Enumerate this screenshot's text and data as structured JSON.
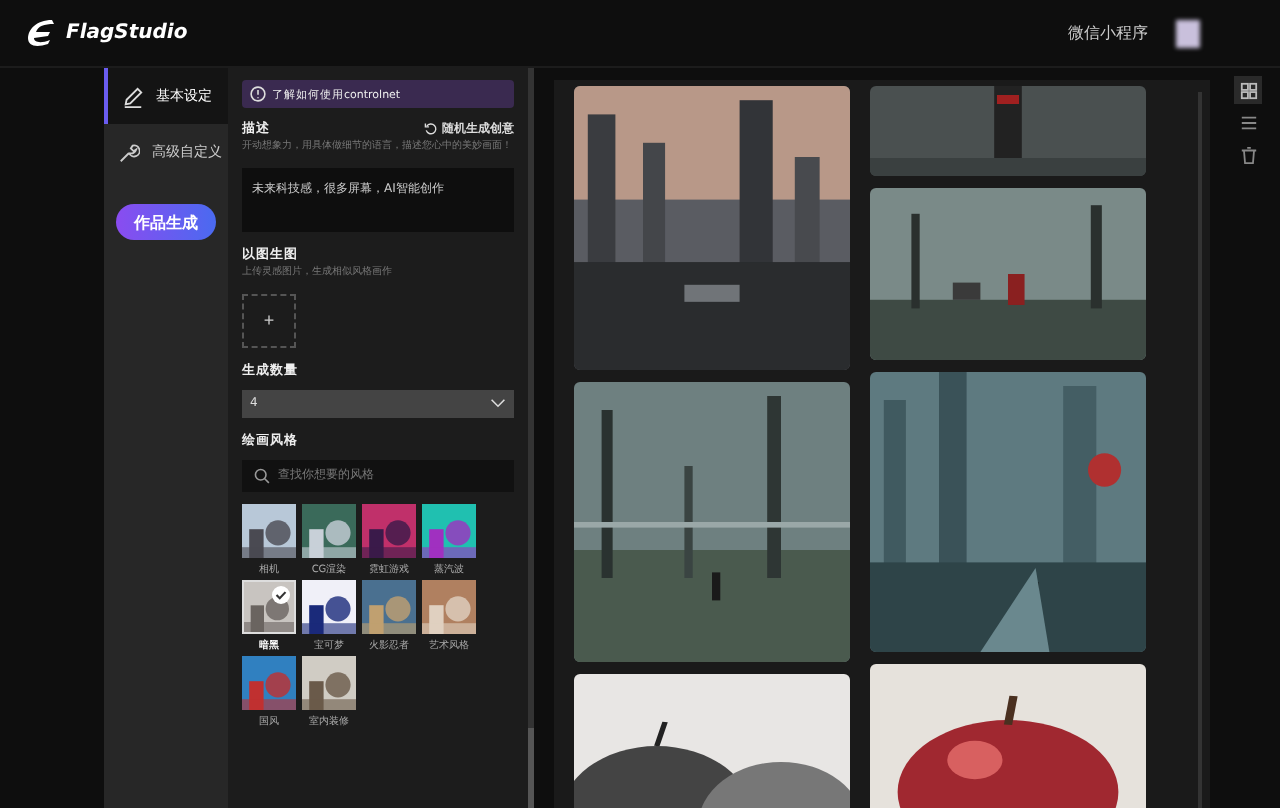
{
  "header": {
    "logo": "FlagStudio",
    "mini_program": "微信小程序"
  },
  "nav": {
    "items": [
      {
        "label": "基本设定",
        "kind": "pencil",
        "selected": true
      },
      {
        "label": "高级自定义",
        "kind": "wrench",
        "selected": false
      }
    ],
    "generate_button": "作品生成"
  },
  "settings": {
    "notice": "了解如何使用controlnet",
    "description": {
      "title": "描述",
      "random_button": "随机生成创意",
      "hint": "开动想象力，用具体做细节的语言，描述您心中的美妙画面！",
      "value": "未来科技感，很多屏幕，AI智能创作"
    },
    "image_to_image": {
      "title": "以图生图",
      "hint": "上传灵感图片，生成相似风格画作",
      "upload": "+"
    },
    "count": {
      "title": "生成数量",
      "value": "4"
    },
    "styles": {
      "title": "绘画风格",
      "placeholder": "查找你想要的风格",
      "items": [
        {
          "label": "相机",
          "selected": false
        },
        {
          "label": "CG渲染",
          "selected": false
        },
        {
          "label": "霓虹游戏",
          "selected": false
        },
        {
          "label": "蒸汽波",
          "selected": false
        },
        {
          "label": "暗黑",
          "selected": true
        },
        {
          "label": "宝可梦",
          "selected": false
        },
        {
          "label": "火影忍者",
          "selected": false
        },
        {
          "label": "艺术风格",
          "selected": false
        },
        {
          "label": "国风",
          "selected": false
        },
        {
          "label": "室内装修",
          "selected": false
        }
      ]
    }
  },
  "view_tools": [
    {
      "kind": "grid",
      "selected": true
    },
    {
      "kind": "list",
      "selected": false
    },
    {
      "kind": "trash",
      "selected": false
    }
  ]
}
